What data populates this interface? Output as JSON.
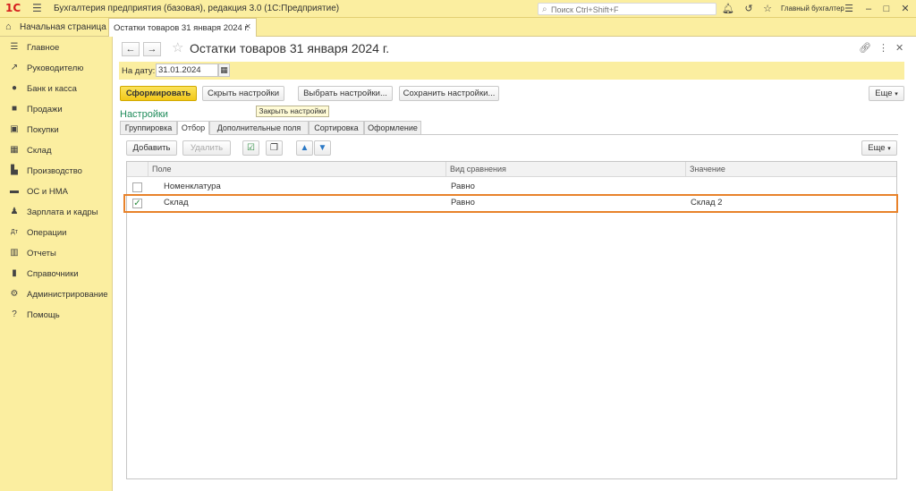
{
  "app": {
    "title": "Бухгалтерия предприятия (базовая), редакция 3.0  (1С:Предприятие)",
    "logo": "1С",
    "search_placeholder": "Поиск Ctrl+Shift+F",
    "user": "Главный бухгалтер"
  },
  "tabs": {
    "home": "Начальная страница",
    "document": "Остатки товаров 31 января 2024 г."
  },
  "sidebar": {
    "items": [
      {
        "label": "Главное",
        "icon": "menu-lines-icon"
      },
      {
        "label": "Руководителю",
        "icon": "trend-icon"
      },
      {
        "label": "Банк и касса",
        "icon": "coin-icon"
      },
      {
        "label": "Продажи",
        "icon": "bag-icon"
      },
      {
        "label": "Покупки",
        "icon": "cart-icon"
      },
      {
        "label": "Склад",
        "icon": "warehouse-icon"
      },
      {
        "label": "Производство",
        "icon": "factory-icon"
      },
      {
        "label": "ОС и НМА",
        "icon": "truck-icon"
      },
      {
        "label": "Зарплата и кадры",
        "icon": "person-icon"
      },
      {
        "label": "Операции",
        "icon": "operations-icon"
      },
      {
        "label": "Отчеты",
        "icon": "chart-icon"
      },
      {
        "label": "Справочники",
        "icon": "book-icon"
      },
      {
        "label": "Администрирование",
        "icon": "gear-icon"
      },
      {
        "label": "Помощь",
        "icon": "question-icon"
      }
    ]
  },
  "document": {
    "title": "Остатки товаров 31 января 2024 г.",
    "date_label": "На дату:",
    "date_value": "31.01.2024"
  },
  "toolbar": {
    "generate": "Сформировать",
    "hide_settings": "Скрыть настройки",
    "choose_settings": "Выбрать настройки...",
    "save_settings": "Сохранить настройки...",
    "more": "Еще"
  },
  "tooltip": "Закрыть настройки",
  "settings": {
    "title": "Настройки",
    "tabs": [
      "Группировка",
      "Отбор",
      "Дополнительные поля",
      "Сортировка",
      "Оформление"
    ],
    "active_tab": "Отбор",
    "add": "Добавить",
    "delete": "Удалить",
    "more": "Еще"
  },
  "grid": {
    "columns": [
      "Поле",
      "Вид сравнения",
      "Значение"
    ],
    "rows": [
      {
        "checked": false,
        "field": "Номенклатура",
        "comparison": "Равно",
        "value": ""
      },
      {
        "checked": true,
        "field": "Склад",
        "comparison": "Равно",
        "value": "Склад 2"
      }
    ]
  },
  "colors": {
    "accent_yellow": "#fbeea0",
    "primary_button": "#f2c81a",
    "settings_title": "#1e8b5a",
    "highlight": "#e8822a"
  }
}
